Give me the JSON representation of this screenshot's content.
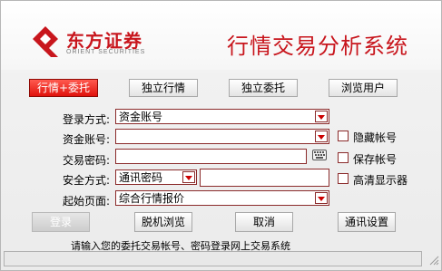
{
  "header": {
    "logo_cn": "东方证券",
    "logo_en": "ORIENT SECURITIES",
    "app_title": "行情交易分析系统"
  },
  "tabs": [
    "行情+委托",
    "独立行情",
    "独立委托",
    "浏览用户"
  ],
  "form": {
    "login_mode_label": "登录方式:",
    "login_mode_value": "资金账号",
    "account_label": "资金账号:",
    "account_value": "",
    "password_label": "交易密码:",
    "password_value": "",
    "security_label": "安全方式:",
    "security_value": "通讯密码",
    "security_extra_value": "",
    "start_page_label": "起始页面:",
    "start_page_value": "综合行情报价"
  },
  "checkboxes": {
    "hide_account": "隐藏帐号",
    "save_account": "保存帐号",
    "hd_display": "高清显示器"
  },
  "buttons": {
    "login": "登录",
    "offline": "脱机浏览",
    "cancel": "取消",
    "comm_settings": "通讯设置"
  },
  "status_text": "请输入您的委托交易帐号、密码登录网上交易系统",
  "colors": {
    "brand_red": "#c8161d",
    "active_tab": "#e0120c",
    "field_border": "#8b2b2b"
  }
}
